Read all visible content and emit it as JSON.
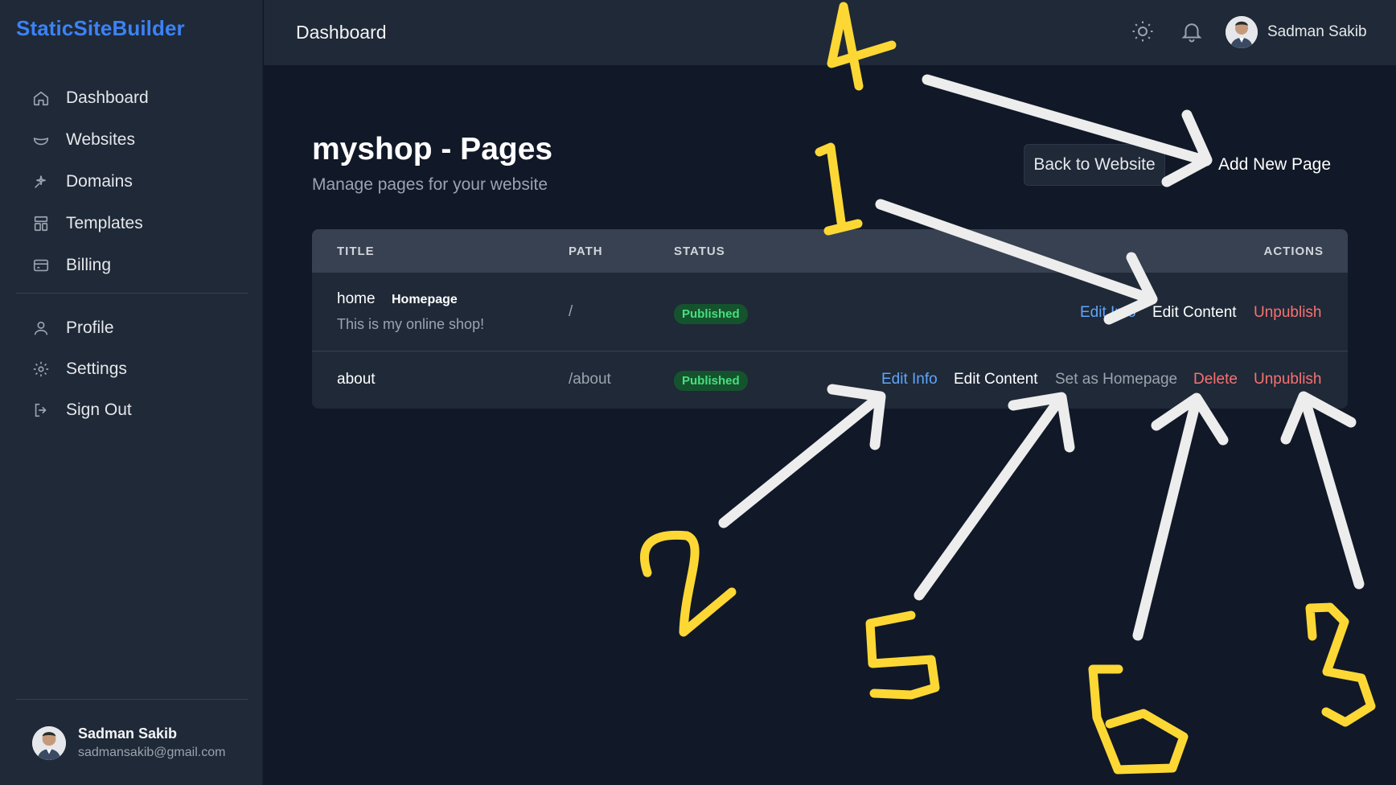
{
  "app": {
    "brand": "StaticSiteBuilder"
  },
  "sidebar": {
    "items": [
      {
        "label": "Dashboard",
        "icon": "home-icon"
      },
      {
        "label": "Websites",
        "icon": "bowl-icon"
      },
      {
        "label": "Domains",
        "icon": "sparkle-icon"
      },
      {
        "label": "Templates",
        "icon": "layout-icon"
      },
      {
        "label": "Billing",
        "icon": "credit-card-icon"
      }
    ],
    "secondary": [
      {
        "label": "Profile",
        "icon": "user-icon"
      },
      {
        "label": "Settings",
        "icon": "gear-icon"
      },
      {
        "label": "Sign Out",
        "icon": "sign-out-icon"
      }
    ],
    "user": {
      "name": "Sadman Sakib",
      "email": "sadmansakib@gmail.com"
    }
  },
  "header": {
    "title": "Dashboard",
    "user_name": "Sadman Sakib"
  },
  "main": {
    "title": "myshop - Pages",
    "subtitle": "Manage pages for your website",
    "back_button": "Back to Website",
    "add_button": "Add New Page",
    "columns": {
      "title": "TITLE",
      "path": "PATH",
      "status": "STATUS",
      "actions": "ACTIONS"
    },
    "rows": [
      {
        "title": "home",
        "badge": "Homepage",
        "description": "This is my online shop!",
        "path": "/",
        "status": "Published",
        "actions": {
          "edit_info": "Edit Info",
          "edit_content": "Edit Content",
          "unpublish": "Unpublish"
        }
      },
      {
        "title": "about",
        "path": "/about",
        "status": "Published",
        "actions": {
          "edit_info": "Edit Info",
          "edit_content": "Edit Content",
          "set_homepage": "Set as Homepage",
          "delete": "Delete",
          "unpublish": "Unpublish"
        }
      }
    ]
  },
  "annotations": {
    "labels": [
      "4",
      "1",
      "2",
      "5",
      "6",
      "3"
    ],
    "arrow_color": "#ededed",
    "number_color": "#fdd835"
  },
  "colors": {
    "background": "#111827",
    "panel": "#1f2937",
    "brand": "#3b82f6",
    "link_blue": "#60a5fa",
    "danger": "#f87171",
    "success": "#4ade80"
  }
}
